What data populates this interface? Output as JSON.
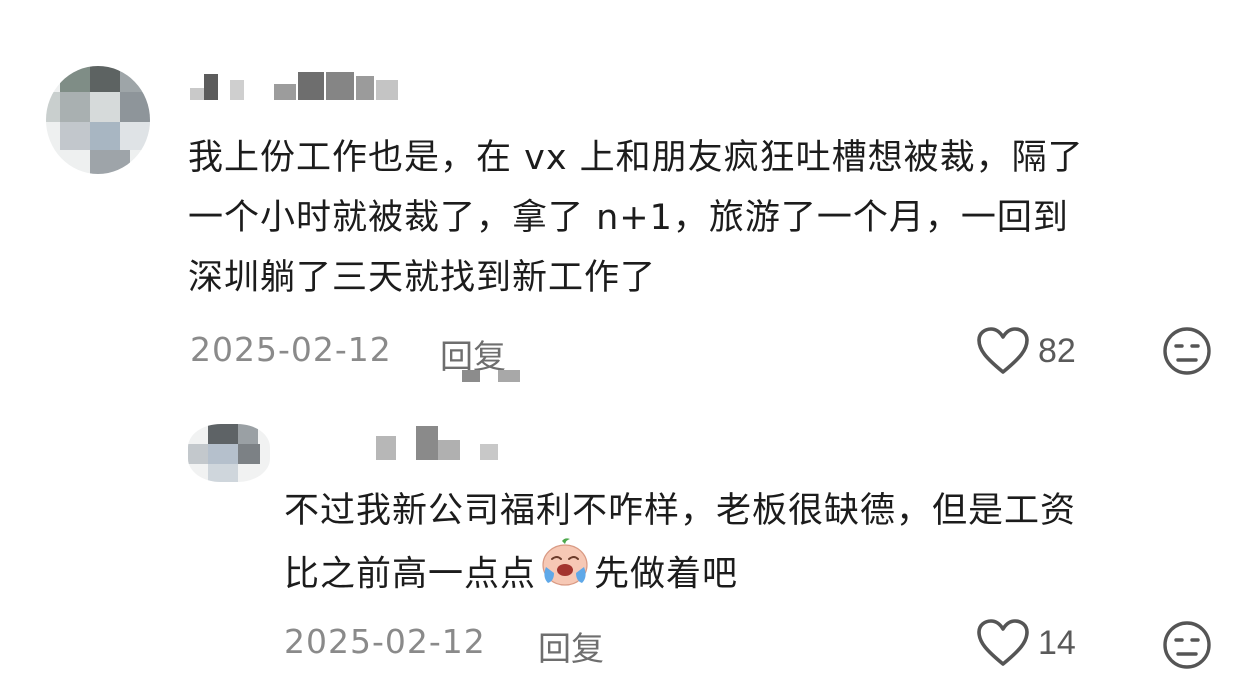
{
  "comments": [
    {
      "text_lines": [
        "我上份工作也是，在 vx 上和朋友疯狂吐槽想被裁，隔了",
        "一个小时就被裁了，拿了 n+1，旅游了一个月，一回到",
        "深圳躺了三天就找到新工作了"
      ],
      "date": "2025-02-12",
      "reply_label": "回复",
      "likes": "82",
      "icons": {
        "like": "heart-icon",
        "dislike": "meh-face-icon"
      }
    },
    {
      "text_lines": [
        "不过我新公司福利不咋样，老板很缺德，但是工资",
        "比之前高一点点",
        "先做着吧"
      ],
      "emoji": "crying-face-emoji",
      "date": "2025-02-12",
      "reply_label": "回复",
      "likes": "14",
      "icons": {
        "like": "heart-icon",
        "dislike": "meh-face-icon"
      }
    }
  ],
  "colors": {
    "text": "#1c1c1c",
    "meta": "#8a8a8a",
    "icon": "#555555",
    "background": "#ffffff"
  }
}
